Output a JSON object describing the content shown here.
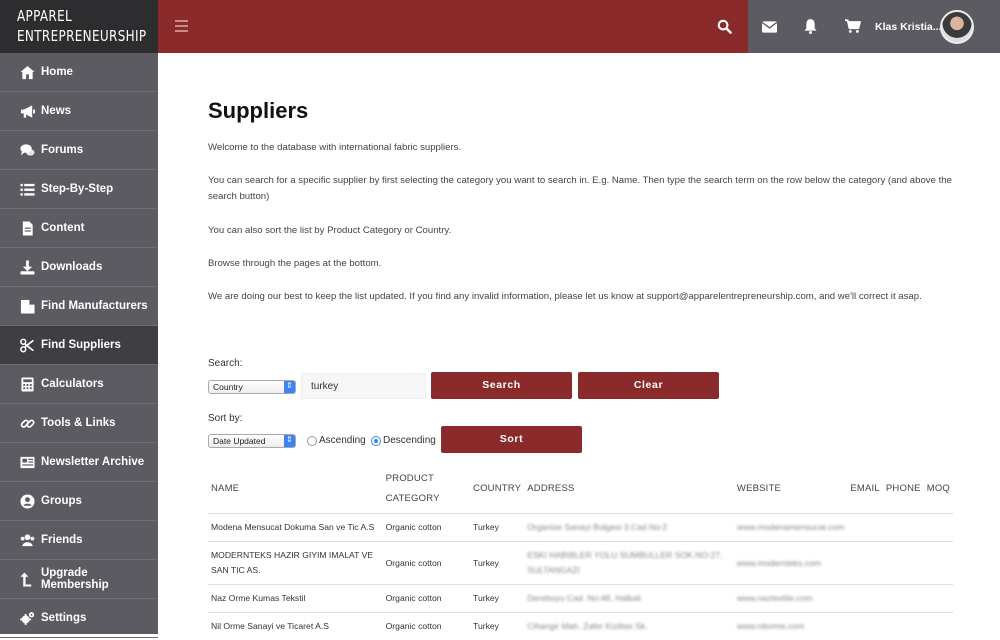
{
  "brand": {
    "line1": "APPAREL",
    "line2": "ENTREPRENEURSHIP"
  },
  "sidebar": {
    "items": [
      {
        "label": "Home",
        "icon": "home-icon"
      },
      {
        "label": "News",
        "icon": "megaphone-icon"
      },
      {
        "label": "Forums",
        "icon": "comments-icon"
      },
      {
        "label": "Step-By-Step",
        "icon": "list-icon"
      },
      {
        "label": "Content",
        "icon": "file-icon"
      },
      {
        "label": "Downloads",
        "icon": "download-icon"
      },
      {
        "label": "Find Manufacturers",
        "icon": "building-icon"
      },
      {
        "label": "Find Suppliers",
        "icon": "scissors-icon"
      },
      {
        "label": "Calculators",
        "icon": "calculator-icon"
      },
      {
        "label": "Tools & Links",
        "icon": "link-icon"
      },
      {
        "label": "Newsletter Archive",
        "icon": "newspaper-icon"
      },
      {
        "label": "Groups",
        "icon": "user-circle-icon"
      },
      {
        "label": "Friends",
        "icon": "users-icon"
      },
      {
        "label": "Upgrade Membership",
        "icon": "level-up-icon"
      },
      {
        "label": "Settings",
        "icon": "cogs-icon"
      }
    ],
    "active_index": 7
  },
  "header": {
    "username": "Klas Kristia..."
  },
  "colors": {
    "brand_red": "#8b2a2a",
    "sidebar_gray": "#5b5b61"
  },
  "page": {
    "title": "Suppliers",
    "paragraphs": [
      "Welcome to the database with international fabric suppliers.",
      "You can search for a specific supplier by first selecting the category you want to search in. E.g. Name. Then type the search term on the row below the category (and above the search button)",
      "You can also sort the list by Product Category or Country.",
      "Browse through the pages at the bottom.",
      "We are doing our best to keep the list updated. If you find any invalid information, please let us know at support@apparelentrepreneurship.com, and we'll correct it asap."
    ]
  },
  "search": {
    "label": "Search:",
    "category_selected": "Country",
    "term_value": "turkey",
    "search_button": "Search",
    "clear_button": "Clear"
  },
  "sort": {
    "label": "Sort by:",
    "field_selected": "Date Updated",
    "ascending_label": "Ascending",
    "descending_label": "Descending",
    "selected": "Descending",
    "sort_button": "Sort"
  },
  "table": {
    "columns": [
      "NAME",
      "PRODUCT CATEGORY",
      "COUNTRY",
      "ADDRESS",
      "WEBSITE",
      "EMAIL",
      "PHONE",
      "MOQ"
    ],
    "rows": [
      {
        "name": "Modena Mensucat Dokuma San ve Tic A.S",
        "category": "Organic cotton",
        "country": "Turkey",
        "address": "Organize Sanayi Bolgesi 3.Cad No:2",
        "website": "www.modenamensucat.com",
        "email": "",
        "phone": "",
        "moq": ""
      },
      {
        "name": "MODERNTEKS HAZIR GIYIM IMALAT VE SAN TIC AS.",
        "category": "Organic cotton",
        "country": "Turkey",
        "address": "ESKI HABIBLER YOLU SUMBULLER SOK.NO:27, SULTANGAZI",
        "website": "www.modernteks.com",
        "email": "",
        "phone": "",
        "moq": ""
      },
      {
        "name": "Naz Orme Kumas Tekstil",
        "category": "Organic cotton",
        "country": "Turkey",
        "address": "Dereboyu Cad. No:48, Halkali",
        "website": "www.naztextile.com",
        "email": "",
        "phone": "",
        "moq": ""
      },
      {
        "name": "Nil Orme Sanayi ve Ticaret A.S",
        "category": "Organic cotton",
        "country": "Turkey",
        "address": "Cihangir Mah. Zafer Kiziltas Sk.",
        "website": "www.nilorme.com",
        "email": "",
        "phone": "",
        "moq": ""
      }
    ]
  }
}
